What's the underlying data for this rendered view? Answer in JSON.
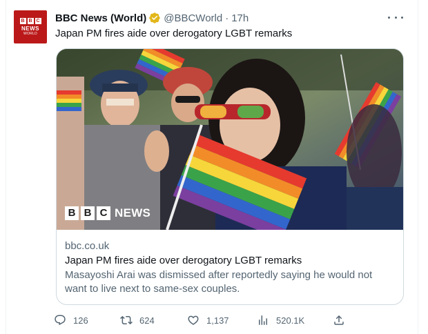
{
  "account": {
    "display_name": "BBC News (World)",
    "handle": "@BBCWorld",
    "separator": "·",
    "time_ago": "17h",
    "avatar_letters": [
      "B",
      "B",
      "C"
    ],
    "avatar_line1": "NEWS",
    "avatar_line2": "WORLD",
    "verified_icon": "gold-verified-badge-icon",
    "verified_color": "#e2b719"
  },
  "tweet": {
    "text": "Japan PM fires aide over derogatory LGBT remarks"
  },
  "card": {
    "domain": "bbc.co.uk",
    "title": "Japan PM fires aide over derogatory LGBT remarks",
    "description": "Masayoshi Arai was dismissed after reportedly saying he would not want to live next to same-sex couples.",
    "image_watermark": {
      "letters": [
        "B",
        "B",
        "C"
      ],
      "word": "NEWS"
    }
  },
  "actions": {
    "replies": "126",
    "retweets": "624",
    "likes": "1,137",
    "views": "520.1K"
  },
  "colors": {
    "text_primary": "#0f1419",
    "text_secondary": "#536471",
    "border": "#cfd9de",
    "bbc_red": "#bb1919"
  }
}
